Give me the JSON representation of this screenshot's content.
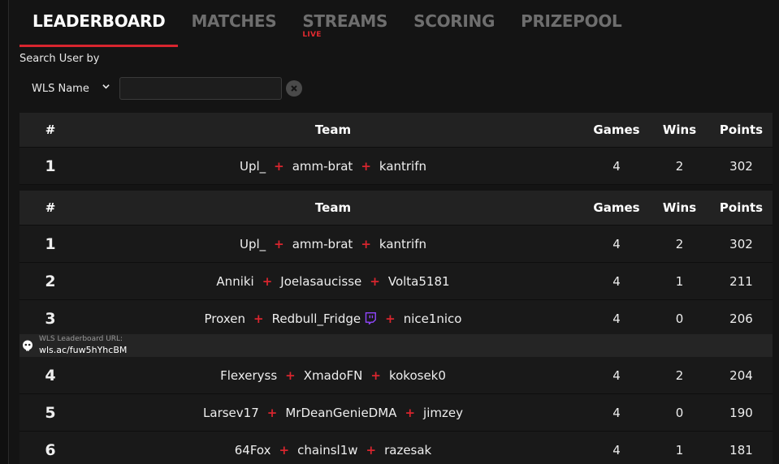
{
  "tabs": [
    {
      "label": "LEADERBOARD",
      "active": true
    },
    {
      "label": "MATCHES"
    },
    {
      "label": "STREAMS",
      "badge": "LIVE"
    },
    {
      "label": "SCORING"
    },
    {
      "label": "PRIZEPOOL"
    }
  ],
  "search": {
    "label": "Search User by",
    "select_value": "WLS Name",
    "input_value": "",
    "clear_icon": "close-circle-icon"
  },
  "table_headers": {
    "rank": "#",
    "team": "Team",
    "games": "Games",
    "wins": "Wins",
    "points": "Points"
  },
  "highlighted_row": {
    "rank": "1",
    "players": [
      "Upl_",
      "amm-brat",
      "kantrifn"
    ],
    "games": "4",
    "wins": "2",
    "points": "302"
  },
  "rows": [
    {
      "rank": "1",
      "players": [
        "Upl_",
        "amm-brat",
        "kantrifn"
      ],
      "games": "4",
      "wins": "2",
      "points": "302"
    },
    {
      "rank": "2",
      "players": [
        "Anniki",
        "Joelasaucisse",
        "Volta5181"
      ],
      "games": "4",
      "wins": "1",
      "points": "211"
    },
    {
      "rank": "3",
      "players": [
        "Proxen",
        "Redbull_Fridge",
        "nice1nico"
      ],
      "games": "4",
      "wins": "0",
      "points": "206"
    },
    {
      "rank": "4",
      "players": [
        "Flexeryss",
        "XmadoFN",
        "kokosek0"
      ],
      "games": "4",
      "wins": "2",
      "points": "204"
    },
    {
      "rank": "5",
      "players": [
        "Larsev17",
        "MrDeanGenieDMA",
        "jimzey"
      ],
      "games": "4",
      "wins": "0",
      "points": "190"
    },
    {
      "rank": "6",
      "players": [
        "64Fox",
        "chainsl1w",
        "razesak"
      ],
      "games": "4",
      "wins": "1",
      "points": "181"
    }
  ],
  "banner": {
    "line1": "WLS Leaderboard URL:",
    "line2": "wls.ac/fuw5hYhcBM"
  },
  "colors": {
    "accent": "#d8252e",
    "twitch": "#9146ff"
  }
}
